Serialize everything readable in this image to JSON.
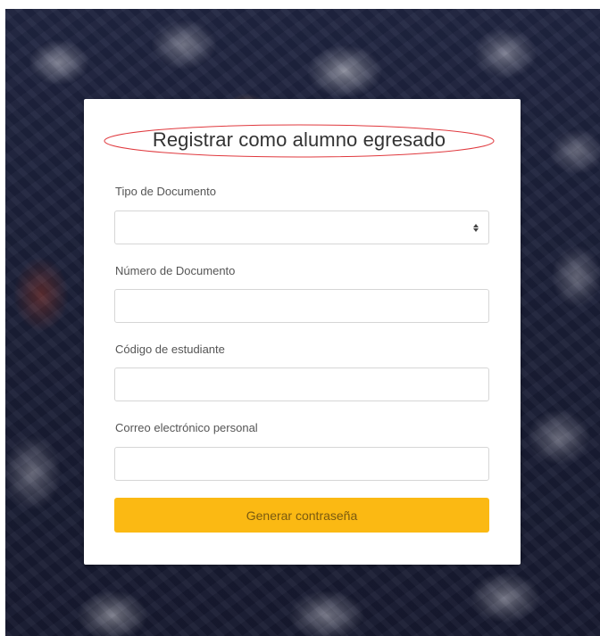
{
  "form": {
    "title": "Registrar como alumno egresado",
    "fields": [
      {
        "label": "Tipo de Documento",
        "value": "",
        "type": "select"
      },
      {
        "label": "Número de Documento",
        "value": ""
      },
      {
        "label": "Código de estudiante",
        "value": ""
      },
      {
        "label": "Correo electrónico personal",
        "value": ""
      }
    ],
    "submit_label": "Generar contraseña"
  },
  "colors": {
    "background": "#1f2440",
    "card": "#ffffff",
    "button": "#fbb913",
    "title_highlight": "#e0393e"
  },
  "icons": {
    "select_arrow": "sort-arrows-icon"
  }
}
